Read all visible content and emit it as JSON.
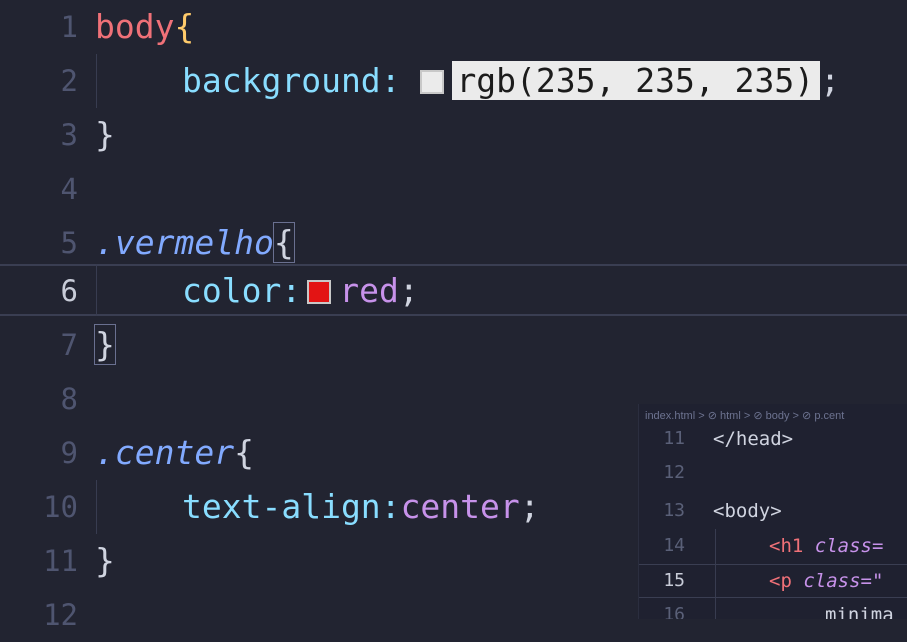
{
  "editor": {
    "line_numbers": [
      "1",
      "2",
      "3",
      "4",
      "5",
      "6",
      "7",
      "8",
      "9",
      "10",
      "11",
      "12"
    ],
    "active_line": "6",
    "lines": {
      "l1_selector": "body",
      "l1_brace": "{",
      "l2_prop": "background",
      "l2_colon": ":",
      "l2_value": "rgb(235, 235, 235)",
      "l2_semi": ";",
      "l3_brace": "}",
      "l5_selector": ".vermelho",
      "l5_brace": "{",
      "l6_prop": "color",
      "l6_colon": ":",
      "l6_value": "red",
      "l6_semi": ";",
      "l7_brace": "}",
      "l9_selector": ".center",
      "l9_brace": "{",
      "l10_prop": "text-align",
      "l10_colon": ":",
      "l10_value": "center",
      "l10_semi": ";",
      "l11_brace": "}"
    },
    "swatches": {
      "background": "#ebebeb",
      "color": "#e31414"
    }
  },
  "preview": {
    "breadcrumb": [
      "index.html",
      "html",
      "body",
      "p.cent"
    ],
    "breadcrumb_sep": ">",
    "line_numbers": [
      "11",
      "12",
      "13",
      "14",
      "15",
      "16"
    ],
    "active_line": "15",
    "l11": "</head>",
    "l13": "<body>",
    "l14_tag": "<h1",
    "l14_attr": "class=",
    "l15_tag": "<p",
    "l15_attr": "class=\"",
    "l16_text": "minima"
  }
}
